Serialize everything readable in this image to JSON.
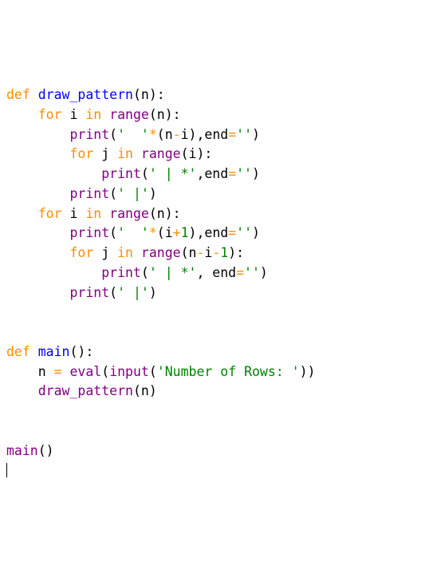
{
  "code": {
    "lines": [
      {
        "indent": 0,
        "tokens": [
          {
            "c": "kw",
            "t": "def"
          },
          {
            "c": "pn",
            "t": " "
          },
          {
            "c": "fn",
            "t": "draw_pattern"
          },
          {
            "c": "pn",
            "t": "(n):"
          }
        ]
      },
      {
        "indent": 1,
        "tokens": [
          {
            "c": "kw",
            "t": "for"
          },
          {
            "c": "pn",
            "t": " i "
          },
          {
            "c": "kw",
            "t": "in"
          },
          {
            "c": "pn",
            "t": " "
          },
          {
            "c": "call",
            "t": "range"
          },
          {
            "c": "pn",
            "t": "(n):"
          }
        ]
      },
      {
        "indent": 2,
        "tokens": [
          {
            "c": "call",
            "t": "print"
          },
          {
            "c": "pn",
            "t": "("
          },
          {
            "c": "str",
            "t": "'  '"
          },
          {
            "c": "op",
            "t": "*"
          },
          {
            "c": "pn",
            "t": "(n"
          },
          {
            "c": "op",
            "t": "-"
          },
          {
            "c": "pn",
            "t": "i),end"
          },
          {
            "c": "op",
            "t": "="
          },
          {
            "c": "str",
            "t": "''"
          },
          {
            "c": "pn",
            "t": ")"
          }
        ]
      },
      {
        "indent": 2,
        "tokens": [
          {
            "c": "kw",
            "t": "for"
          },
          {
            "c": "pn",
            "t": " j "
          },
          {
            "c": "kw",
            "t": "in"
          },
          {
            "c": "pn",
            "t": " "
          },
          {
            "c": "call",
            "t": "range"
          },
          {
            "c": "pn",
            "t": "(i):"
          }
        ]
      },
      {
        "indent": 3,
        "tokens": [
          {
            "c": "call",
            "t": "print"
          },
          {
            "c": "pn",
            "t": "("
          },
          {
            "c": "str",
            "t": "' | *'"
          },
          {
            "c": "pn",
            "t": ",end"
          },
          {
            "c": "op",
            "t": "="
          },
          {
            "c": "str",
            "t": "''"
          },
          {
            "c": "pn",
            "t": ")"
          }
        ]
      },
      {
        "indent": 2,
        "tokens": [
          {
            "c": "call",
            "t": "print"
          },
          {
            "c": "pn",
            "t": "("
          },
          {
            "c": "str",
            "t": "' |'"
          },
          {
            "c": "pn",
            "t": ")"
          }
        ]
      },
      {
        "indent": 1,
        "tokens": [
          {
            "c": "kw",
            "t": "for"
          },
          {
            "c": "pn",
            "t": " i "
          },
          {
            "c": "kw",
            "t": "in"
          },
          {
            "c": "pn",
            "t": " "
          },
          {
            "c": "call",
            "t": "range"
          },
          {
            "c": "pn",
            "t": "(n):"
          }
        ]
      },
      {
        "indent": 2,
        "tokens": [
          {
            "c": "call",
            "t": "print"
          },
          {
            "c": "pn",
            "t": "("
          },
          {
            "c": "str",
            "t": "'  '"
          },
          {
            "c": "op",
            "t": "*"
          },
          {
            "c": "pn",
            "t": "(i"
          },
          {
            "c": "op",
            "t": "+"
          },
          {
            "c": "num",
            "t": "1"
          },
          {
            "c": "pn",
            "t": "),end"
          },
          {
            "c": "op",
            "t": "="
          },
          {
            "c": "str",
            "t": "''"
          },
          {
            "c": "pn",
            "t": ")"
          }
        ]
      },
      {
        "indent": 2,
        "tokens": [
          {
            "c": "kw",
            "t": "for"
          },
          {
            "c": "pn",
            "t": " j "
          },
          {
            "c": "kw",
            "t": "in"
          },
          {
            "c": "pn",
            "t": " "
          },
          {
            "c": "call",
            "t": "range"
          },
          {
            "c": "pn",
            "t": "(n"
          },
          {
            "c": "op",
            "t": "-"
          },
          {
            "c": "pn",
            "t": "i"
          },
          {
            "c": "op",
            "t": "-"
          },
          {
            "c": "num",
            "t": "1"
          },
          {
            "c": "pn",
            "t": "):"
          }
        ]
      },
      {
        "indent": 3,
        "tokens": [
          {
            "c": "call",
            "t": "print"
          },
          {
            "c": "pn",
            "t": "("
          },
          {
            "c": "str",
            "t": "' | *'"
          },
          {
            "c": "pn",
            "t": ", end"
          },
          {
            "c": "op",
            "t": "="
          },
          {
            "c": "str",
            "t": "''"
          },
          {
            "c": "pn",
            "t": ")"
          }
        ]
      },
      {
        "indent": 2,
        "tokens": [
          {
            "c": "call",
            "t": "print"
          },
          {
            "c": "pn",
            "t": "("
          },
          {
            "c": "str",
            "t": "' |'"
          },
          {
            "c": "pn",
            "t": ")"
          }
        ]
      },
      {
        "indent": 0,
        "tokens": []
      },
      {
        "indent": 0,
        "tokens": []
      },
      {
        "indent": 0,
        "tokens": [
          {
            "c": "kw",
            "t": "def"
          },
          {
            "c": "pn",
            "t": " "
          },
          {
            "c": "fn",
            "t": "main"
          },
          {
            "c": "pn",
            "t": "():"
          }
        ]
      },
      {
        "indent": 1,
        "tokens": [
          {
            "c": "pn",
            "t": "n "
          },
          {
            "c": "op",
            "t": "="
          },
          {
            "c": "pn",
            "t": " "
          },
          {
            "c": "call",
            "t": "eval"
          },
          {
            "c": "pn",
            "t": "("
          },
          {
            "c": "call",
            "t": "input"
          },
          {
            "c": "pn",
            "t": "("
          },
          {
            "c": "str",
            "t": "'Number of Rows: '"
          },
          {
            "c": "pn",
            "t": "))"
          }
        ]
      },
      {
        "indent": 1,
        "tokens": [
          {
            "c": "call",
            "t": "draw_pattern"
          },
          {
            "c": "pn",
            "t": "(n)"
          }
        ]
      },
      {
        "indent": 0,
        "tokens": []
      },
      {
        "indent": 0,
        "tokens": []
      },
      {
        "indent": 0,
        "tokens": [
          {
            "c": "call",
            "t": "main"
          },
          {
            "c": "pn",
            "t": "()"
          }
        ]
      }
    ],
    "indent_unit": "    "
  }
}
